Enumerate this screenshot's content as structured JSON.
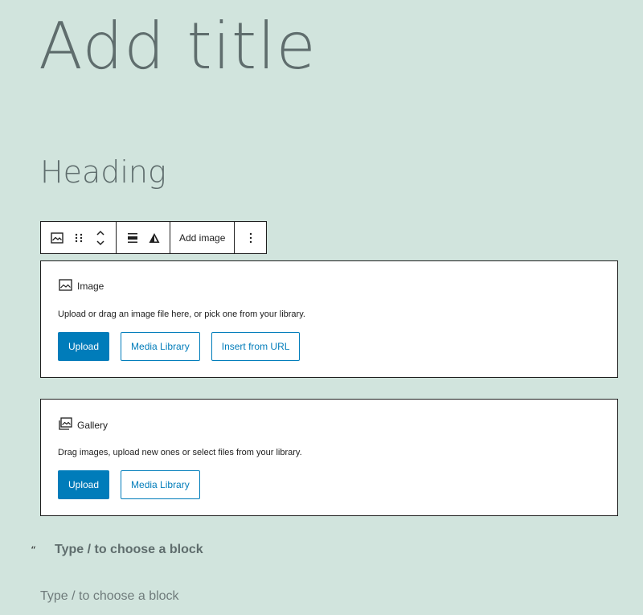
{
  "title": "Add title",
  "heading": "Heading",
  "toolbar": {
    "icons": [
      "image-icon",
      "drag-handle-icon",
      "move-up-down-icon",
      "align-icon",
      "warning-icon",
      "more-options-icon"
    ],
    "add_image_label": "Add image",
    "more_label": "⋮"
  },
  "image_block": {
    "label": "Image",
    "instructions": "Upload or drag an image file here, or pick one from your library.",
    "buttons": [
      "Upload",
      "Media Library",
      "Insert from URL"
    ]
  },
  "gallery_block": {
    "label": "Gallery",
    "instructions": "Drag images, upload new ones or select files from your library.",
    "buttons": [
      "Upload",
      "Media Library"
    ]
  },
  "quote": {
    "mark": "“",
    "placeholder": "Type / to choose a block"
  },
  "paragraph": {
    "placeholder": "Type / to choose a block"
  },
  "colors": {
    "background": "#d1e4dd",
    "primary": "#007cba",
    "text": "#5f6d6d"
  }
}
